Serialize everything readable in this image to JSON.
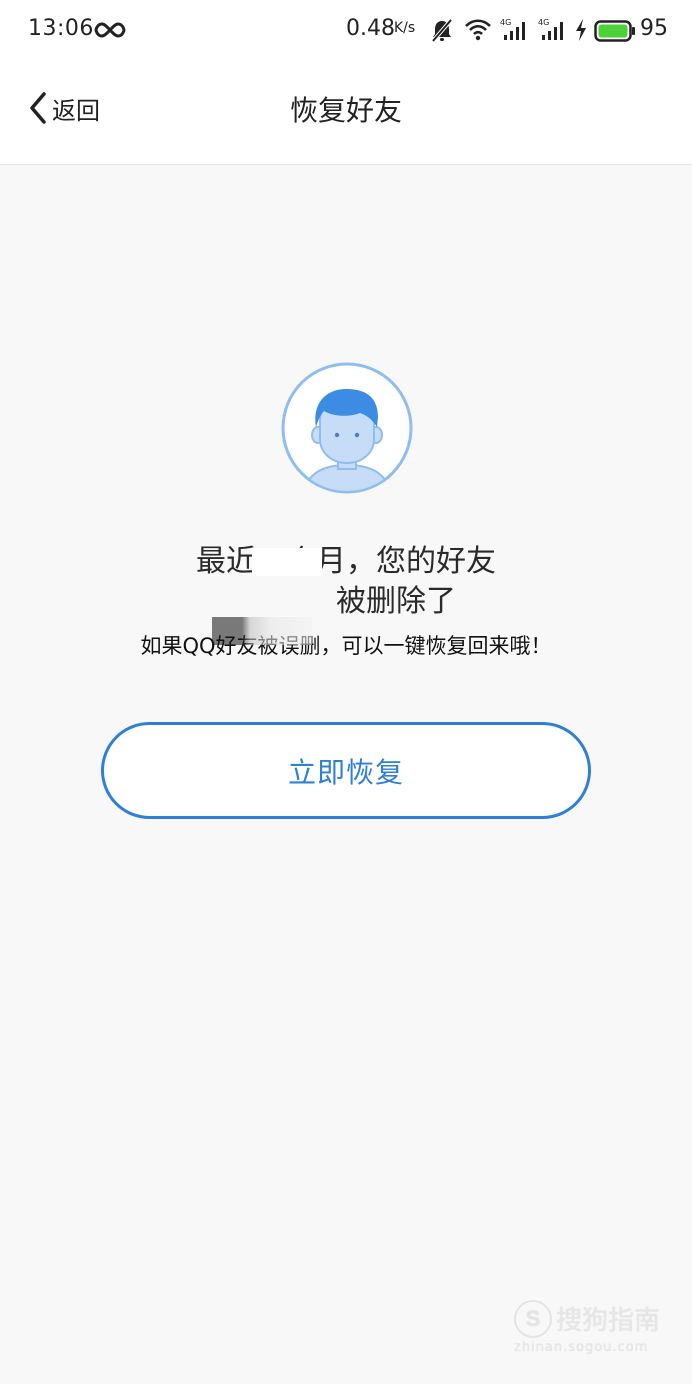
{
  "status_bar": {
    "time": "13:06",
    "net_speed": "0.48",
    "net_speed_unit": "K/s",
    "battery_level": "95",
    "battery_color": "#4cd137",
    "icons": [
      "infinity-icon",
      "mute-icon",
      "wifi-icon",
      "signal-4g-icon",
      "signal-4g-icon",
      "charging-icon",
      "battery-icon"
    ]
  },
  "nav": {
    "back_label": "返回",
    "title": "恢复好友"
  },
  "main": {
    "avatar_icon": "user-avatar-icon",
    "headline_line1": "最近一个月，您的好友",
    "headline_line2": "被删除了",
    "subtitle": "如果QQ好友被误删，可以一键恢复回来哦！",
    "restore_button_label": "立即恢复",
    "accent_color": "#2d7fd8"
  },
  "watermark": {
    "logo_letter": "S",
    "text": "搜狗指南",
    "url": "zhinan.sogou.com"
  }
}
